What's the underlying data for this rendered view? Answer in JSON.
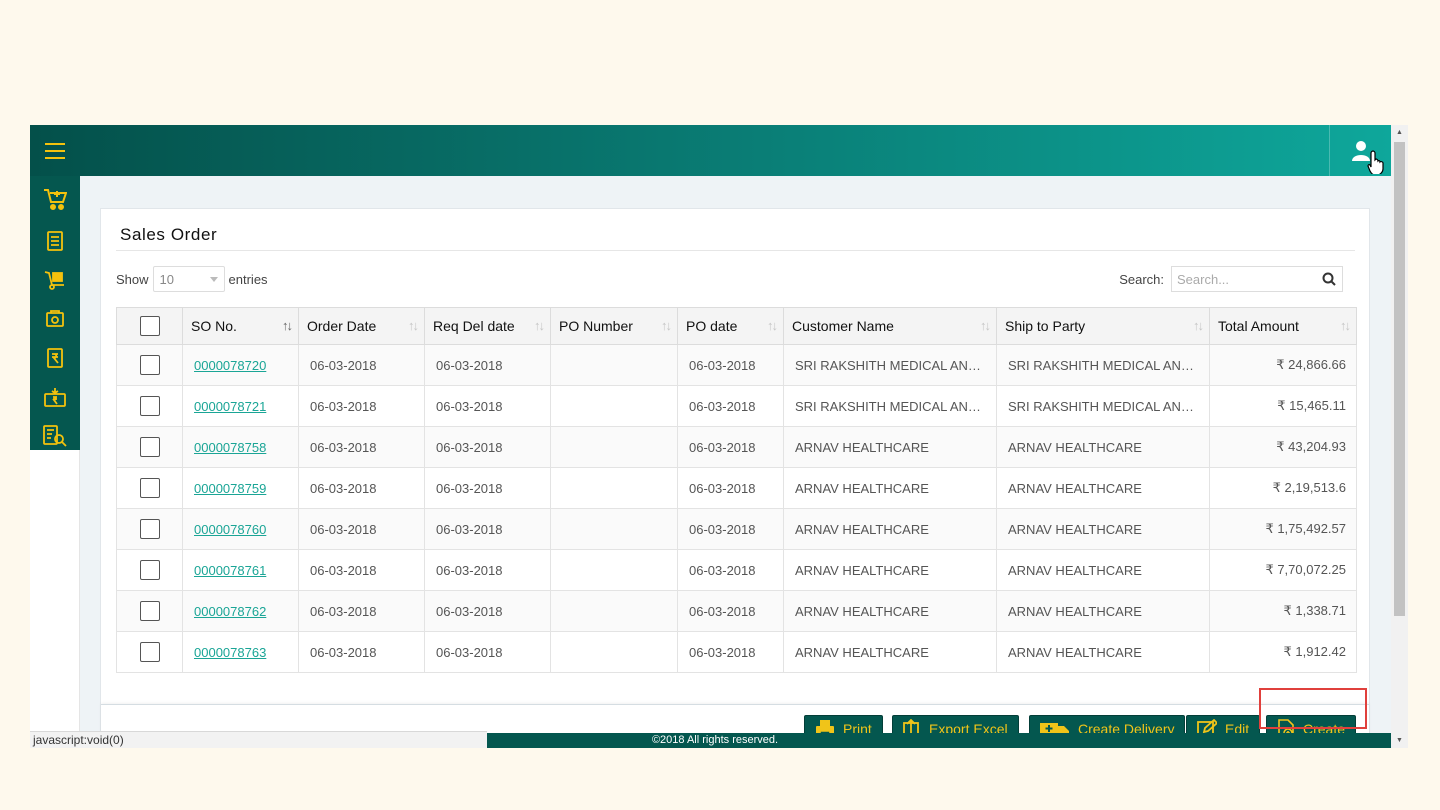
{
  "page": {
    "title": "Sales Order"
  },
  "length_menu": {
    "show_label": "Show",
    "value": "10",
    "entries_label": "entries"
  },
  "search": {
    "label": "Search:",
    "placeholder": "Search..."
  },
  "columns": [
    "SO No.",
    "Order Date",
    "Req Del date",
    "PO Number",
    "PO date",
    "Customer Name",
    "Ship to Party",
    "Total Amount"
  ],
  "rows": [
    {
      "so": "0000078720",
      "order_date": "06-03-2018",
      "req_del": "06-03-2018",
      "po_number": "",
      "po_date": "06-03-2018",
      "customer": "SRI RAKSHITH MEDICAL AND ...",
      "ship_to": "SRI RAKSHITH MEDICAL AND ...",
      "amount": "₹ 24,866.66"
    },
    {
      "so": "0000078721",
      "order_date": "06-03-2018",
      "req_del": "06-03-2018",
      "po_number": "",
      "po_date": "06-03-2018",
      "customer": "SRI RAKSHITH MEDICAL AND ...",
      "ship_to": "SRI RAKSHITH MEDICAL AND ...",
      "amount": "₹ 15,465.11"
    },
    {
      "so": "0000078758",
      "order_date": "06-03-2018",
      "req_del": "06-03-2018",
      "po_number": "",
      "po_date": "06-03-2018",
      "customer": "ARNAV HEALTHCARE",
      "ship_to": "ARNAV HEALTHCARE",
      "amount": "₹ 43,204.93"
    },
    {
      "so": "0000078759",
      "order_date": "06-03-2018",
      "req_del": "06-03-2018",
      "po_number": "",
      "po_date": "06-03-2018",
      "customer": "ARNAV HEALTHCARE",
      "ship_to": "ARNAV HEALTHCARE",
      "amount": "₹ 2,19,513.6"
    },
    {
      "so": "0000078760",
      "order_date": "06-03-2018",
      "req_del": "06-03-2018",
      "po_number": "",
      "po_date": "06-03-2018",
      "customer": "ARNAV HEALTHCARE",
      "ship_to": "ARNAV HEALTHCARE",
      "amount": "₹ 1,75,492.57"
    },
    {
      "so": "0000078761",
      "order_date": "06-03-2018",
      "req_del": "06-03-2018",
      "po_number": "",
      "po_date": "06-03-2018",
      "customer": "ARNAV HEALTHCARE",
      "ship_to": "ARNAV HEALTHCARE",
      "amount": "₹ 7,70,072.25"
    },
    {
      "so": "0000078762",
      "order_date": "06-03-2018",
      "req_del": "06-03-2018",
      "po_number": "",
      "po_date": "06-03-2018",
      "customer": "ARNAV HEALTHCARE",
      "ship_to": "ARNAV HEALTHCARE",
      "amount": "₹ 1,338.71"
    },
    {
      "so": "0000078763",
      "order_date": "06-03-2018",
      "req_del": "06-03-2018",
      "po_number": "",
      "po_date": "06-03-2018",
      "customer": "ARNAV HEALTHCARE",
      "ship_to": "ARNAV HEALTHCARE",
      "amount": "₹ 1,912.42"
    }
  ],
  "actions": {
    "print": "Print",
    "export_excel": "Export Excel",
    "create_delivery": "Create Delivery",
    "edit": "Edit",
    "create": "Create"
  },
  "sidebar_icons": [
    "cart-icon",
    "document-list-icon",
    "hand-truck-icon",
    "cash-register-icon",
    "rupee-document-icon",
    "rupee-exchange-icon",
    "report-search-icon",
    "boxes-icon"
  ],
  "footer": {
    "copyright": "©2018 All rights reserved."
  },
  "status_bar": {
    "text": "javascript:void(0)"
  },
  "colors": {
    "accent": "#04574f",
    "button_text": "#f0c419",
    "link": "#1aa596",
    "highlight": "#e0403c",
    "page_bg": "#fef9ed"
  }
}
